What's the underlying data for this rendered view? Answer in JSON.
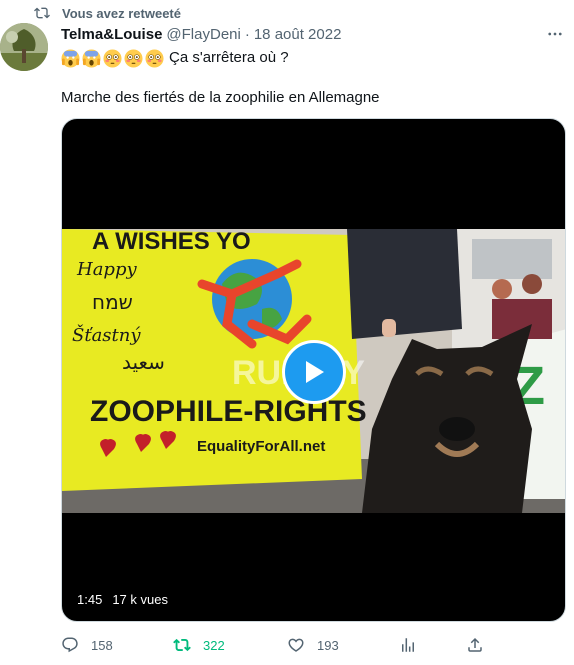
{
  "retweet_banner": {
    "text": "Vous avez retweeté"
  },
  "tweet": {
    "author_name": "Telma&Louise",
    "handle": "@FlayDeni",
    "separator": "·",
    "date": "18 août 2022",
    "text_line1": "Ça s'arrêtera où ?",
    "emojis": [
      "screaming-face-emoji",
      "screaming-face-emoji",
      "flushed-face-emoji",
      "flushed-face-emoji",
      "flushed-face-emoji"
    ],
    "text_line2": "Marche des fiertés de la zoophilie en Allemagne"
  },
  "video": {
    "duration": "1:45",
    "views": "17 k vues",
    "frame": {
      "banner_top": "A WISHES YO",
      "happy": "Happy",
      "hebrew": "שמח",
      "czech": "Šťastný",
      "arabic": "سعيد",
      "main_banner": "ZOOPHILE-RIGHTS",
      "website": "EqualityForAll.net",
      "watermark": "RUPTLY"
    }
  },
  "actions": {
    "replies": "158",
    "retweets": "322",
    "likes": "193"
  },
  "colors": {
    "accent": "#1d9bf0",
    "retweet_green": "#00ba7c",
    "secondary_text": "#536471"
  }
}
